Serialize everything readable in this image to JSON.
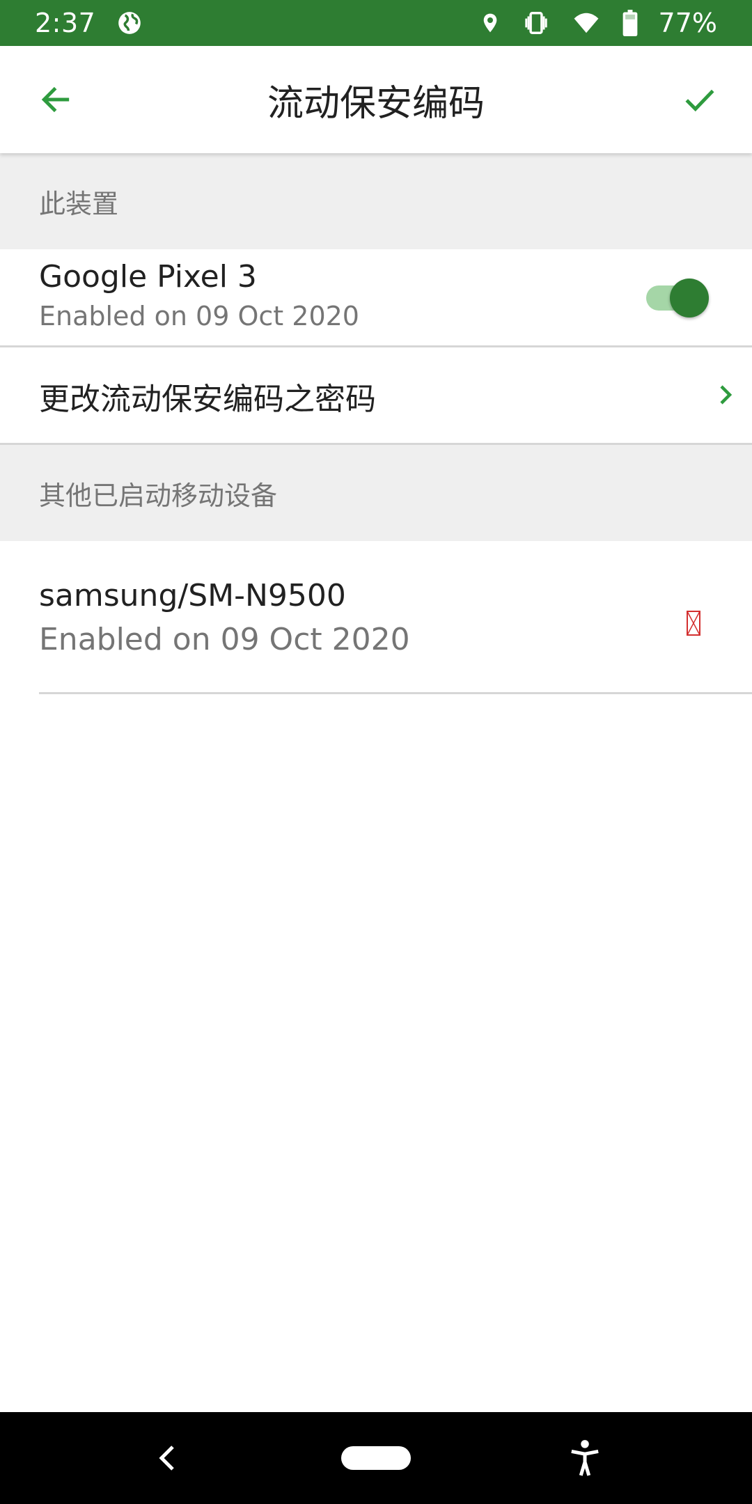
{
  "status_bar": {
    "time": "2:37",
    "battery": "77%",
    "icons": [
      "globe-icon",
      "location-icon",
      "vibrate-icon",
      "wifi-icon",
      "battery-icon"
    ]
  },
  "app_bar": {
    "title": "流动保安编码",
    "back_icon": "arrow-left-icon",
    "confirm_icon": "check-icon"
  },
  "sections": {
    "this_device": {
      "header": "此装置",
      "device": {
        "name": "Google Pixel 3",
        "enabled": "Enabled on 09 Oct 2020",
        "toggle_on": true
      },
      "change_password_label": "更改流动保安编码之密码"
    },
    "other_devices": {
      "header": "其他已启动移动设备",
      "items": [
        {
          "name": "samsung/SM-N9500",
          "enabled": "Enabled on 09 Oct 2020"
        }
      ]
    }
  },
  "colors": {
    "status_bar": "#2e7d32",
    "accent": "#2e9b3e",
    "section_bg": "#efefef",
    "delete": "#d32f2f"
  }
}
